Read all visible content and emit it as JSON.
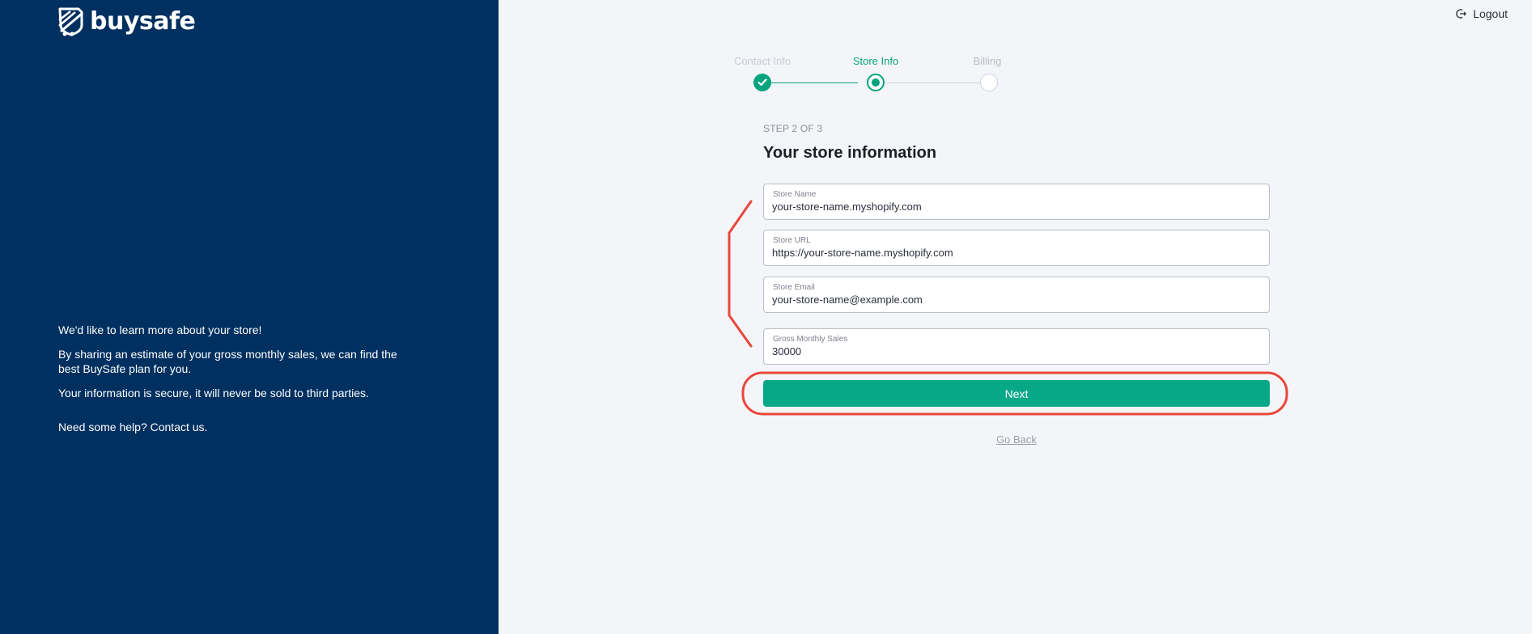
{
  "brand": {
    "name": "buysafe"
  },
  "intro": {
    "line1": "We'd like to learn more about your store!",
    "line2": "By sharing an estimate of your gross monthly sales, we can find the best BuySafe plan for you.",
    "line3": "Your information is secure, it will never be sold to third parties.",
    "help": "Need some help? Contact us."
  },
  "header": {
    "logout_label": "Logout"
  },
  "stepper": {
    "steps": [
      {
        "label": "Contact Info",
        "state": "done"
      },
      {
        "label": "Store Info",
        "state": "active"
      },
      {
        "label": "Billing",
        "state": "pending"
      }
    ]
  },
  "form": {
    "step_count": "STEP 2 OF 3",
    "title": "Your store information",
    "fields": [
      {
        "label": "Store Name",
        "value": "your-store-name.myshopify.com"
      },
      {
        "label": "Store URL",
        "value": "https://your-store-name.myshopify.com"
      },
      {
        "label": "Store Email",
        "value": "your-store-name@example.com"
      },
      {
        "label": "Gross Monthly Sales",
        "value": "30000"
      }
    ],
    "next_label": "Next",
    "go_back_label": "Go Back"
  },
  "colors": {
    "left_panel": "#003060",
    "accent": "#07a887",
    "annotation": "#e8473a"
  }
}
